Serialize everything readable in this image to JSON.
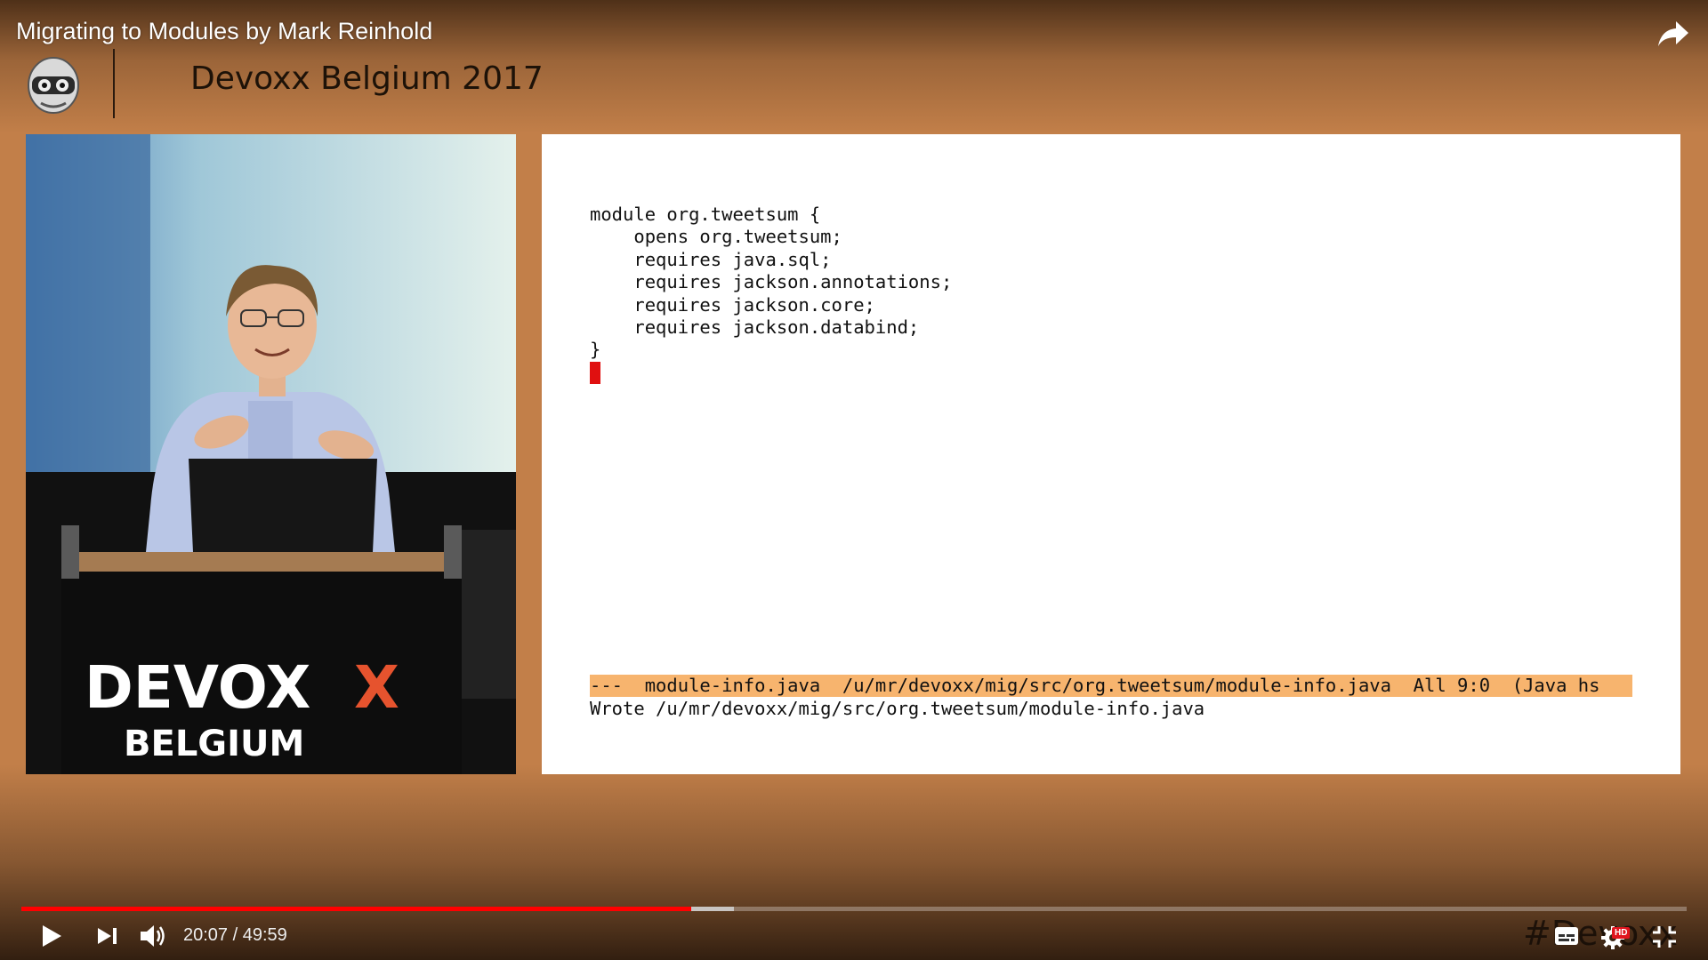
{
  "video": {
    "title": "Migrating to Modules by Mark Reinhold"
  },
  "slide": {
    "conference_title": "Devoxx Belgium 2017",
    "stage_sign_line1": "DEVOX",
    "stage_sign_accent": "X",
    "stage_sign_line2": "BELGIUM",
    "code": "module org.tweetsum {\n    opens org.tweetsum;\n    requires java.sql;\n    requires jackson.annotations;\n    requires jackson.core;\n    requires jackson.databind;\n}",
    "modeline": "---  module-info.java  /u/mr/devoxx/mig/src/org.tweetsum/module-info.java  All 9:0  (Java hs",
    "echo": "Wrote /u/mr/devoxx/mig/src/org.tweetsum/module-info.java"
  },
  "player": {
    "time_display": "20:07 / 49:59",
    "progress_played": 0.402,
    "progress_buffered": 0.428,
    "watermark": "#Devoxx",
    "hd_badge": "HD",
    "accent_color": "#ff0000",
    "icons": [
      "share-icon",
      "play-icon",
      "next-icon",
      "volume-icon",
      "subtitles-icon",
      "settings-icon",
      "exit-fullscreen-icon"
    ]
  }
}
